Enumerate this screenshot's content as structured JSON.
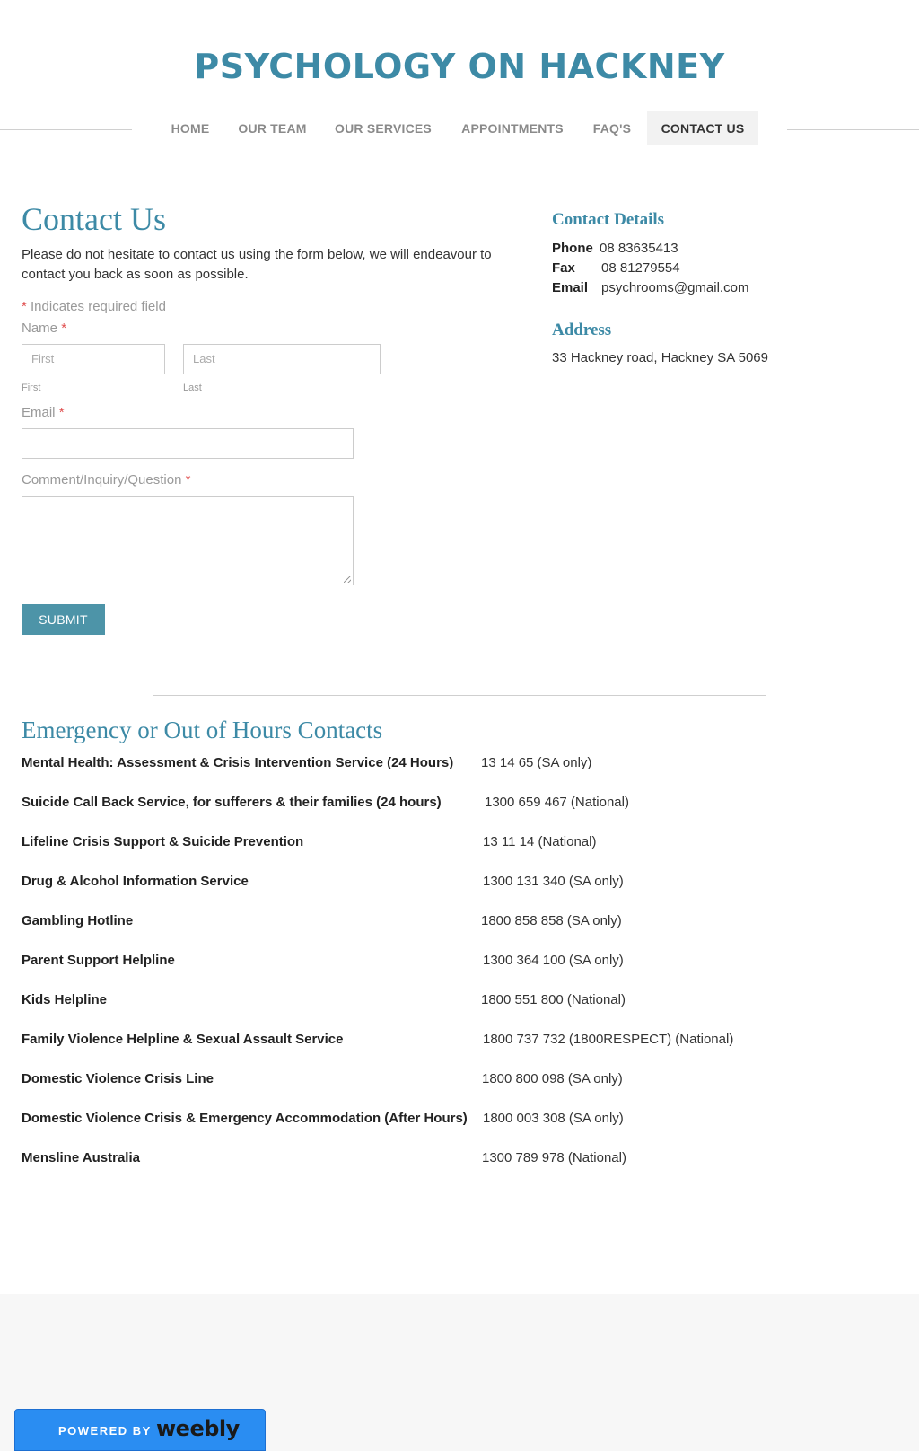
{
  "site": {
    "title": "PSYCHOLOGY ON HACKNEY"
  },
  "nav": {
    "items": [
      {
        "label": "HOME"
      },
      {
        "label": "OUR TEAM"
      },
      {
        "label": "OUR SERVICES"
      },
      {
        "label": "APPOINTMENTS"
      },
      {
        "label": "FAQ'S"
      },
      {
        "label": "CONTACT US",
        "active": true
      }
    ]
  },
  "contact": {
    "title": "Contact Us",
    "intro": "Please do not hesitate to contact us using the form below, we will endeavour to contact you back as soon as possible."
  },
  "form": {
    "required_star": "*",
    "required_note": "Indicates required field",
    "name_label": "Name",
    "first_placeholder": "First",
    "last_placeholder": "Last",
    "first_sublabel": "First",
    "last_sublabel": "Last",
    "email_label": "Email",
    "comment_label": "Comment/Inquiry/Question",
    "submit_label": "SUBMIT"
  },
  "details": {
    "heading": "Contact Details",
    "phone_label": "Phone",
    "phone": "08 83635413",
    "fax_label": "Fax",
    "fax": "08 81279554",
    "email_label": "Email",
    "email": "psychrooms@gmail.com",
    "address_heading": "Address",
    "address": "33 Hackney road, Hackney SA 5069"
  },
  "emergency": {
    "title": "Emergency or Out of Hours Contacts",
    "rows": [
      {
        "name": "Mental Health: Assessment & Crisis Intervention Service (24 Hours)",
        "number": "13 14 65 (SA only)"
      },
      {
        "name": "Suicide Call Back Service, for sufferers & their families (24 hours)",
        "number": "1300 659 467 (National)"
      },
      {
        "name": "Lifeline Crisis Support & Suicide Prevention",
        "number": "13 11 14 (National)"
      },
      {
        "name": "Drug & Alcohol Information Service",
        "number": "1300 131 340 (SA only)"
      },
      {
        "name": "Gambling Hotline",
        "number": "1800 858 858 (SA only)"
      },
      {
        "name": "Parent Support Helpline",
        "number": "1300 364 100 (SA only)"
      },
      {
        "name": "Kids Helpline",
        "number": "1800 551 800 (National)"
      },
      {
        "name": "Family Violence Helpline & Sexual Assault Service",
        "number": "1800 737 732 (1800RESPECT) (National)"
      },
      {
        "name": "Domestic Violence Crisis Line",
        "number": "1800 800 098 (SA only)"
      },
      {
        "name": "Domestic Violence Crisis & Emergency Accommodation (After Hours)",
        "number": "1800 003 308 (SA only)"
      },
      {
        "name": "Mensline Australia",
        "number": "1300 789 978 (National)"
      }
    ]
  },
  "footer": {
    "powered_by": "POWERED BY",
    "brand": "weebly"
  },
  "colors": {
    "accent": "#3d8aa6",
    "button": "#4d94a8",
    "required": "#e05050",
    "badge": "#2a8df2"
  }
}
